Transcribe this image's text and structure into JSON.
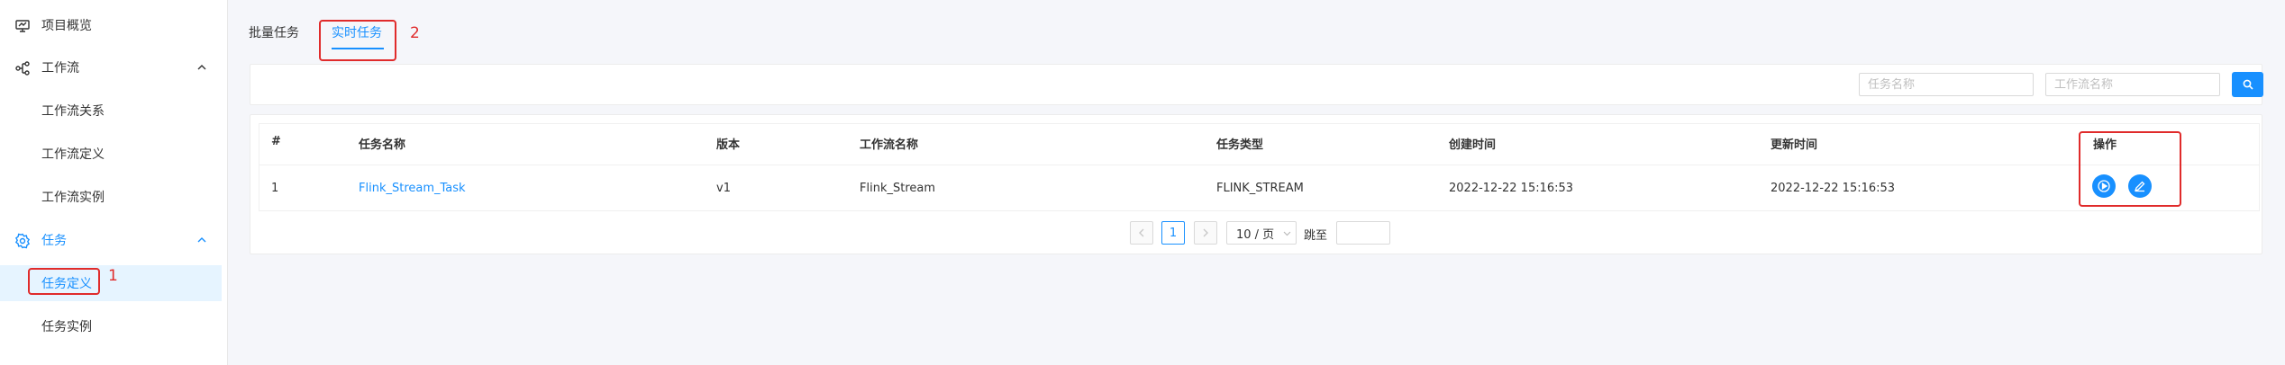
{
  "sidebar": {
    "items": [
      {
        "label": "项目概览",
        "icon": "monitor-icon"
      },
      {
        "label": "工作流",
        "icon": "workflow-icon"
      },
      {
        "label": "工作流关系"
      },
      {
        "label": "工作流定义"
      },
      {
        "label": "工作流实例"
      },
      {
        "label": "任务",
        "icon": "gear-icon"
      },
      {
        "label": "任务定义"
      },
      {
        "label": "任务实例"
      }
    ]
  },
  "annotations": {
    "sidebar_marker": "1",
    "tab_marker": "2"
  },
  "tabs": [
    {
      "label": "批量任务",
      "active": false
    },
    {
      "label": "实时任务",
      "active": true
    }
  ],
  "filters": {
    "task_name_placeholder": "任务名称",
    "workflow_name_placeholder": "工作流名称",
    "search_icon": "search-icon"
  },
  "table": {
    "headers": [
      "#",
      "任务名称",
      "版本",
      "工作流名称",
      "任务类型",
      "创建时间",
      "更新时间",
      "操作"
    ],
    "rows": [
      {
        "index": "1",
        "task_name": "Flink_Stream_Task",
        "version": "v1",
        "workflow_name": "Flink_Stream",
        "task_type": "FLINK_STREAM",
        "created": "2022-12-22 15:16:53",
        "updated": "2022-12-22 15:16:53",
        "actions": [
          "play-icon",
          "edit-icon"
        ]
      }
    ]
  },
  "pagination": {
    "current_page": "1",
    "page_size": "10 / 页",
    "jump_label": "跳至"
  },
  "colors": {
    "primary": "#1890ff",
    "annotation": "#e02b2b"
  }
}
